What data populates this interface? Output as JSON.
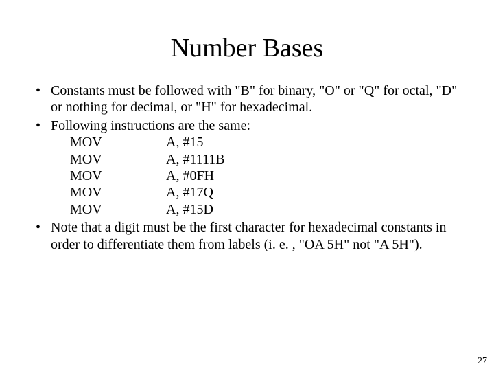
{
  "slide": {
    "title": "Number Bases",
    "page_number": "27",
    "bullets": {
      "b1": "Constants must be followed with \"B\" for binary, \"O\" or \"Q\" for octal, \"D\" or nothing for decimal, or \"H\" for hexadecimal.",
      "b2_intro": "Following instructions are the same:",
      "b3": "Note that a digit must be the first character for hexadecimal constants in order to differentiate them from labels (i. e. , \"OA 5H\" not \"A 5H\")."
    },
    "instructions": {
      "r0": {
        "op": "MOV",
        "arg": "A, #15"
      },
      "r1": {
        "op": "MOV",
        "arg": "A, #1111B"
      },
      "r2": {
        "op": "MOV",
        "arg": "A, #0FH"
      },
      "r3": {
        "op": "MOV",
        "arg": "A, #17Q"
      },
      "r4": {
        "op": "MOV",
        "arg": "A, #15D"
      }
    }
  }
}
